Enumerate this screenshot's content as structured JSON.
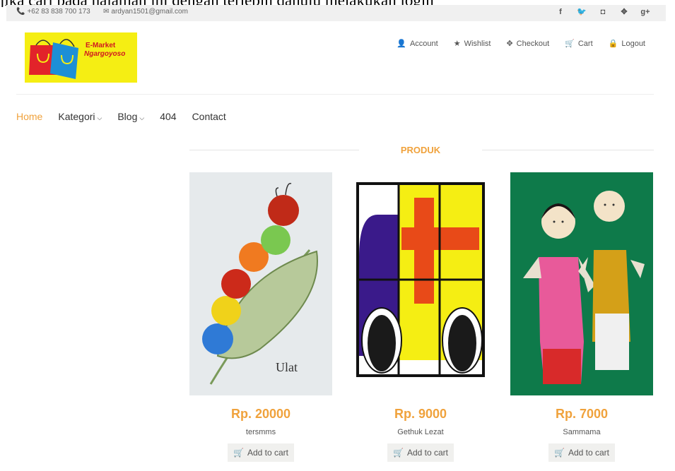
{
  "caption": "jika cari pada halaman ini dengan terlebih dahulu melakukan login",
  "topbar": {
    "phone": "+62 83 838 700 173",
    "email": "ardyan1501@gmail.com",
    "social_icons": [
      {
        "name": "facebook-icon",
        "glyph": "f"
      },
      {
        "name": "twitter-icon",
        "glyph": "🐦"
      },
      {
        "name": "instagram-icon",
        "glyph": "◘"
      },
      {
        "name": "dribbble-icon",
        "glyph": "✥"
      },
      {
        "name": "googleplus-icon",
        "glyph": "g+"
      }
    ]
  },
  "logo": {
    "line1": "E-Market",
    "line2": "Ngargoyoso"
  },
  "usernav": [
    {
      "icon": "user-icon",
      "glyph": "👤",
      "label": "Account"
    },
    {
      "icon": "star-icon",
      "glyph": "★",
      "label": "Wishlist"
    },
    {
      "icon": "crosshair-icon",
      "glyph": "✥",
      "label": "Checkout"
    },
    {
      "icon": "cart-icon",
      "glyph": "🛒",
      "label": "Cart"
    },
    {
      "icon": "lock-icon",
      "glyph": "🔒",
      "label": "Logout"
    }
  ],
  "mainnav": [
    {
      "label": "Home",
      "dropdown": false,
      "active": true
    },
    {
      "label": "Kategori",
      "dropdown": true,
      "active": false
    },
    {
      "label": "Blog",
      "dropdown": true,
      "active": false
    },
    {
      "label": "404",
      "dropdown": false,
      "active": false
    },
    {
      "label": "Contact",
      "dropdown": false,
      "active": false
    }
  ],
  "section_title": "PRODUK",
  "products": [
    {
      "price": "Rp. 20000",
      "name": "tersmms",
      "button": "Add to cart",
      "image": "caterpillar-drawing",
      "image_text": "Ulat"
    },
    {
      "price": "Rp. 9000",
      "name": "Gethuk Lezat",
      "button": "Add to cart",
      "image": "ambulance-drawing"
    },
    {
      "price": "Rp. 7000",
      "name": "Sammama",
      "button": "Add to cart",
      "image": "puppets-photo"
    }
  ],
  "colors": {
    "accent": "#f0a23c",
    "logo_bg": "#f5ee13",
    "topbar_bg": "#f0f0f0"
  }
}
